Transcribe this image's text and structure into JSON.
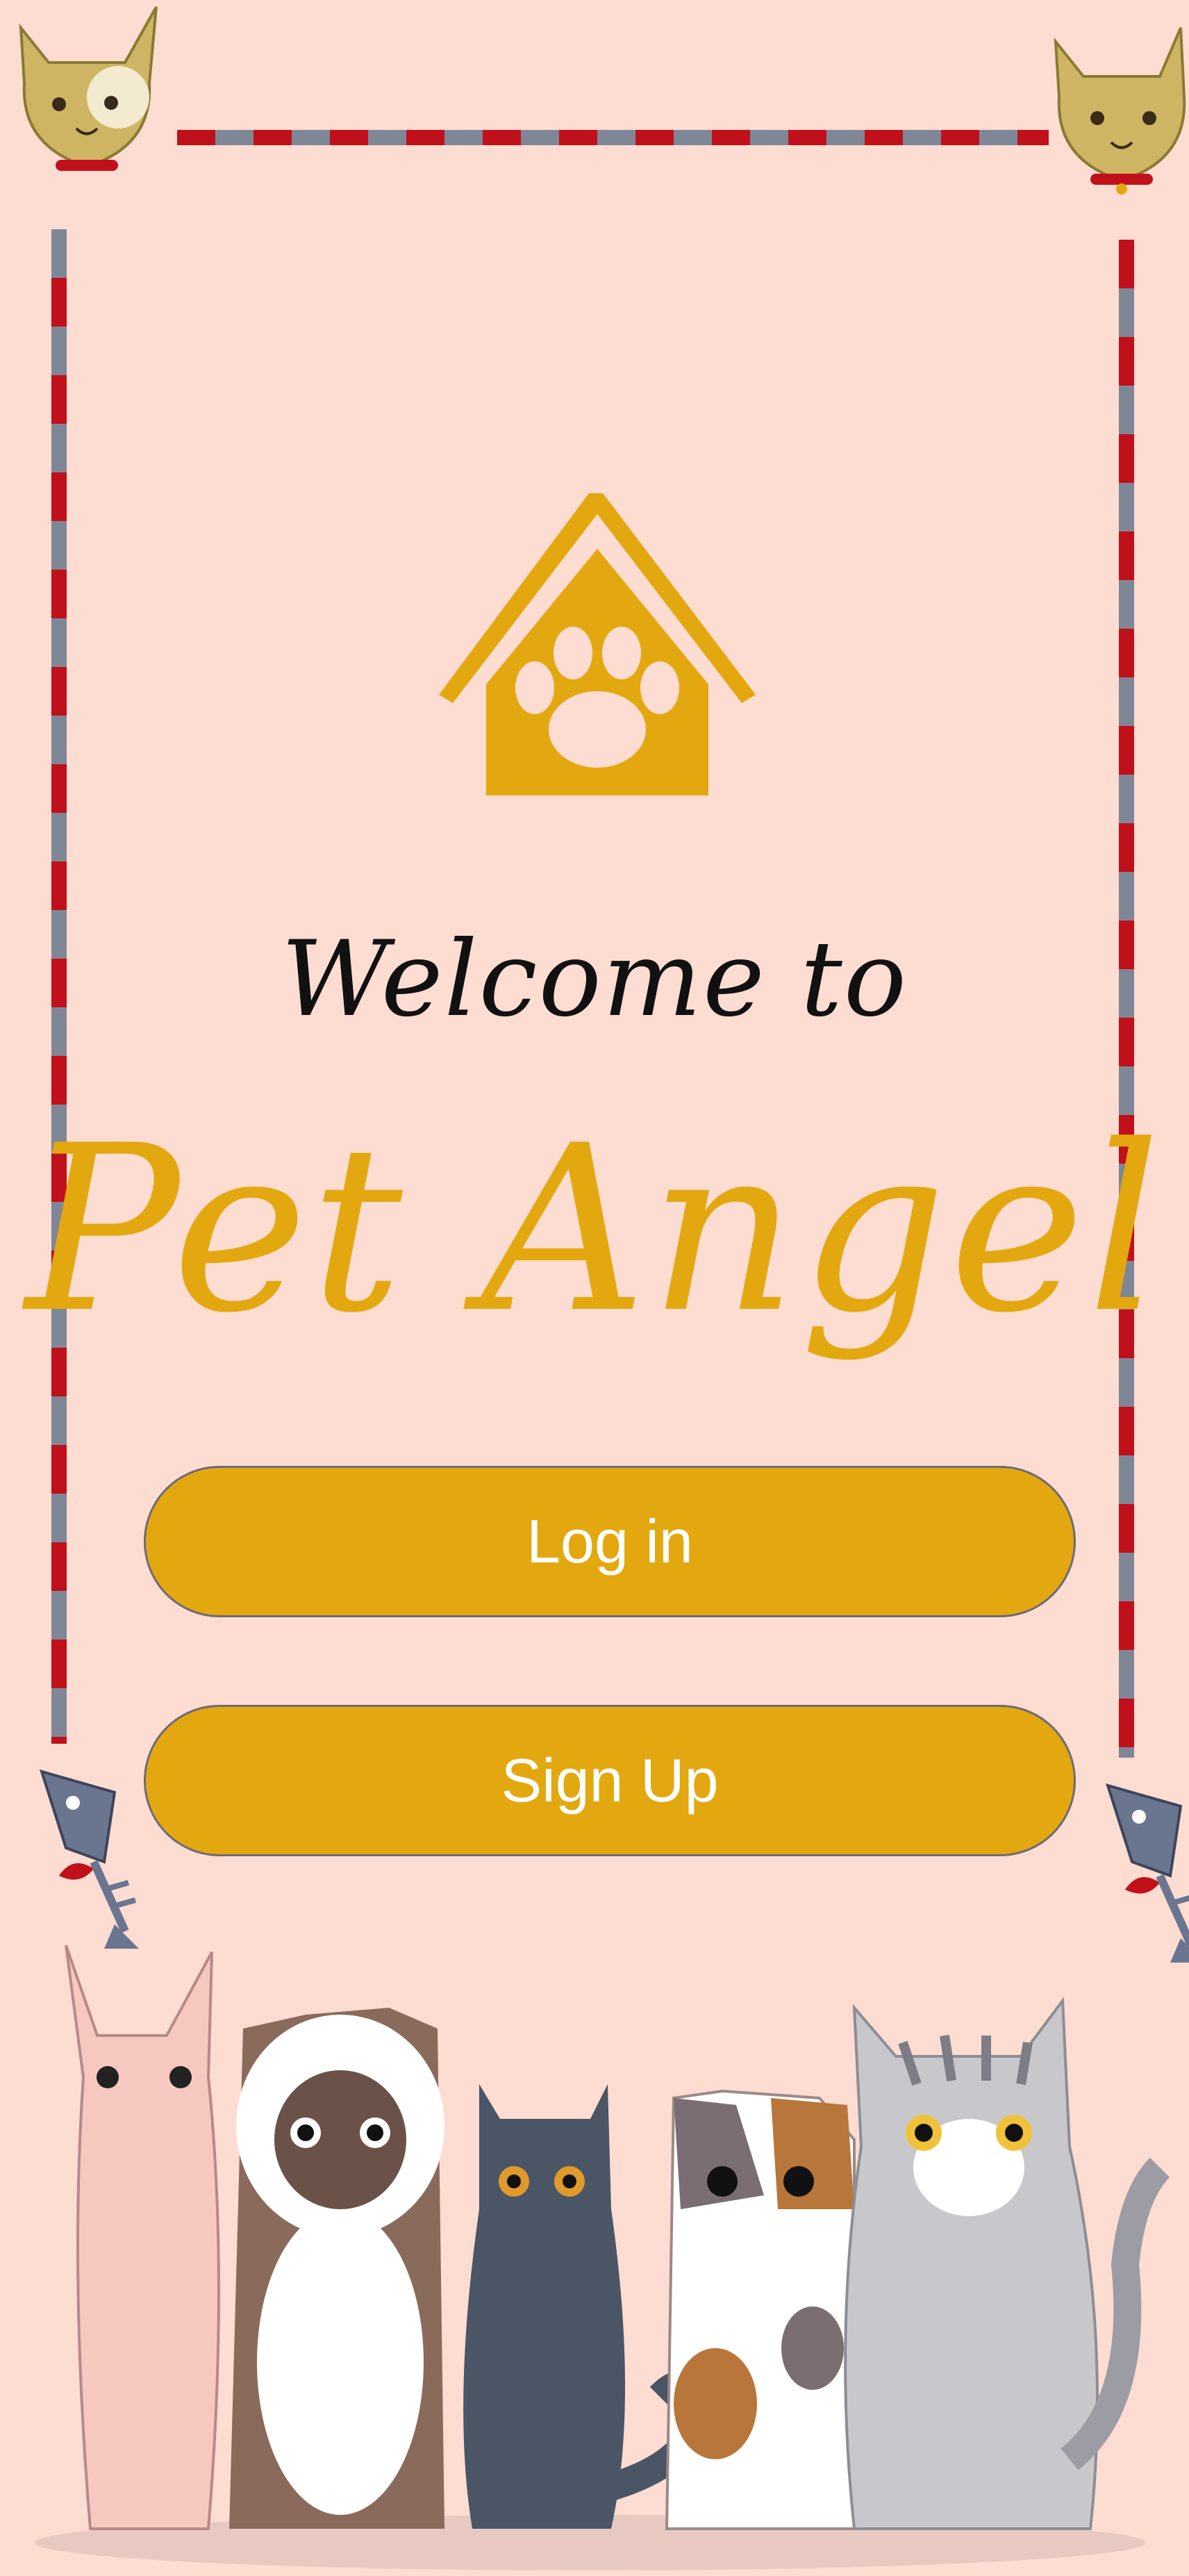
{
  "app": {
    "welcome_text": "Welcome to",
    "title": "Pet Angel"
  },
  "buttons": {
    "login_label": "Log in",
    "signup_label": "Sign Up"
  },
  "icons": {
    "logo": "house-paw-icon",
    "corner_left": "cat-head-icon",
    "corner_right": "cat-head-icon",
    "fish_left": "fishbone-icon",
    "fish_right": "fishbone-icon",
    "illustration": "cats-group-illustration"
  },
  "colors": {
    "background": "#fddcd2",
    "accent": "#e3a80f",
    "button_border": "#6e6a78",
    "frame_red": "#c0101a",
    "frame_gray": "#7f8797",
    "welcome_text": "#111111",
    "button_text": "#ffffff"
  }
}
